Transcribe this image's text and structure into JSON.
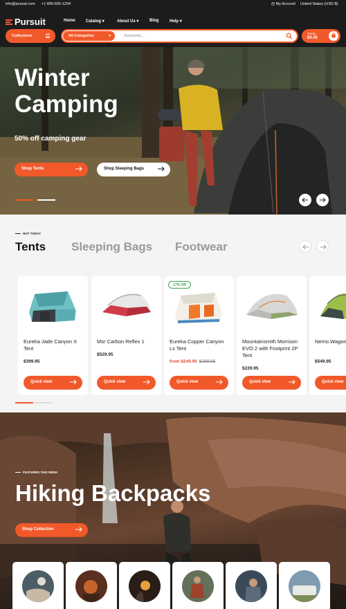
{
  "topbar": {
    "email": "info@pursuit.com",
    "phone": "+1 800-555-1234",
    "account": "My Account",
    "region": "United States (USD $)"
  },
  "brand": {
    "name": "Pursuit",
    "accent": "#f1592a"
  },
  "nav": {
    "items": [
      {
        "label": "Home"
      },
      {
        "label": "Catalog",
        "dropdown": true
      },
      {
        "label": "About Us",
        "dropdown": true
      },
      {
        "label": "Blog"
      },
      {
        "label": "Help",
        "dropdown": true
      }
    ]
  },
  "search": {
    "collections_label": "Collections",
    "category_label": "All Categories",
    "placeholder": "Keywords...",
    "total_label": "TOTAL",
    "total_amount": "$0.00"
  },
  "hero": {
    "title": "Winter Camping",
    "subtitle": "50% off camping gear",
    "primary_button": "Shop Tents",
    "secondary_button": "Shop Sleeping Bags"
  },
  "products": {
    "eyebrow": "HOT TODAY",
    "tabs": [
      {
        "label": "Tents",
        "active": true
      },
      {
        "label": "Sleeping Bags",
        "active": false
      },
      {
        "label": "Footwear",
        "active": false
      }
    ],
    "quick_view_label": "Quick view",
    "items": [
      {
        "name": "Eureka Jade Canyon X Tent",
        "price": "$399.95",
        "icon": "teal-cabin-tent"
      },
      {
        "name": "Msr Carbon Reflex 1",
        "price": "$529.95",
        "icon": "red-dome-tent"
      },
      {
        "name": "Eureka Copper Canyon Lx Tent",
        "badge": "17% Off",
        "sale_price": "from $249.95",
        "old_price": "$299.95",
        "icon": "orange-cabin-tent"
      },
      {
        "name": "Mountainsmith Morrison EVO 2 with Footprint 2P Tent",
        "price": "$229.95",
        "icon": "grey-dome-tent"
      },
      {
        "name": "Nemo Wagontop Tent",
        "price": "$549.95",
        "icon": "green-dome-tent"
      }
    ]
  },
  "featured": {
    "eyebrow": "FEATURED THIS WEEK",
    "title": "Hiking Backpacks",
    "button": "Shop Collection"
  }
}
